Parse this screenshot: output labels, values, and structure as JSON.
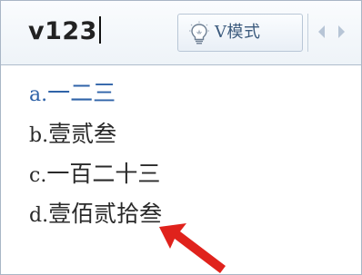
{
  "composition": {
    "text": "v123"
  },
  "toolbar": {
    "mode_label": "V模式",
    "mode_icon": "lightbulb-icon",
    "prev_icon": "chevron-left-icon",
    "next_icon": "chevron-right-icon"
  },
  "candidates": [
    {
      "index": "a.",
      "text": "一二三",
      "selected": true
    },
    {
      "index": "b.",
      "text": "壹贰叁",
      "selected": false
    },
    {
      "index": "c.",
      "text": "一百二十三",
      "selected": false
    },
    {
      "index": "d.",
      "text": "壹佰贰拾叁",
      "selected": false
    }
  ],
  "colors": {
    "selected_text": "#2f63a8",
    "normal_text": "#2a2a2a",
    "annotation_arrow": "#e0221c",
    "border": "#a9b6c6"
  }
}
